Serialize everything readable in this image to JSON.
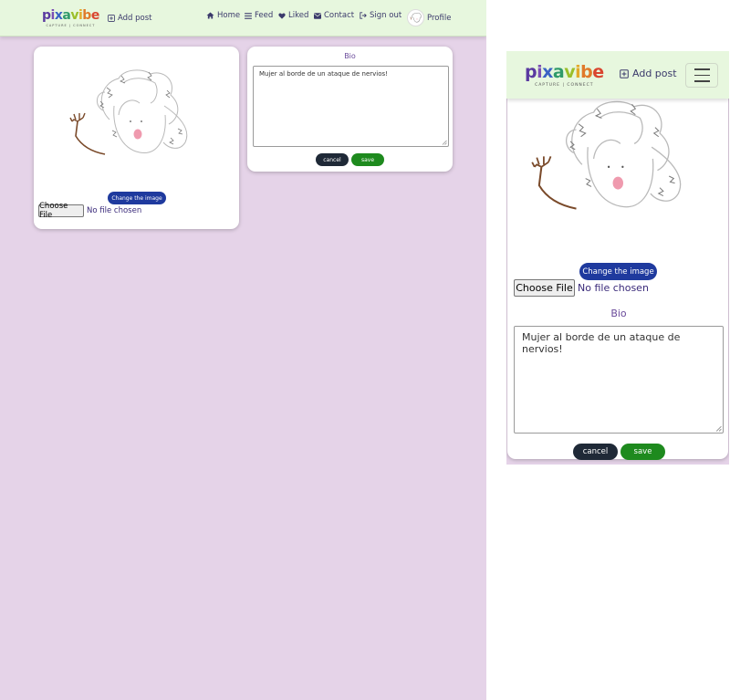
{
  "brand": {
    "logo_letters": [
      {
        "ch": "p",
        "color": "#5a3aa0"
      },
      {
        "ch": "i",
        "color": "#7b4fb5"
      },
      {
        "ch": "x",
        "color": "#3a62c4"
      },
      {
        "ch": "a",
        "color": "#2f9a6a"
      },
      {
        "ch": "v",
        "color": "#9bbf2a"
      },
      {
        "ch": "i",
        "color": "#e3a92a"
      },
      {
        "ch": "b",
        "color": "#e07a2a"
      },
      {
        "ch": "e",
        "color": "#d9452f"
      }
    ],
    "tagline": "CAPTURE | CONNECT"
  },
  "nav": {
    "add_post": "Add post",
    "home": "Home",
    "feed": "Feed",
    "liked": "Liked",
    "contact": "Contact",
    "sign_out": "Sign out",
    "profile": "Profile"
  },
  "profile_image": {
    "change_button": "Change the image",
    "file_button": "Choose File",
    "file_status": "No file chosen"
  },
  "bio": {
    "label": "Bio",
    "value": "Mujer al borde de un ataque de nervios!",
    "cancel": "cancel",
    "save": "save"
  },
  "colors": {
    "page_bg": "#e5d3e8",
    "nav_bg": "#e7f7de",
    "change_btn": "#1f3a9e",
    "cancel_btn": "#1f2937",
    "save_btn": "#1e8a1e",
    "nav_text": "#3b3a6b"
  }
}
